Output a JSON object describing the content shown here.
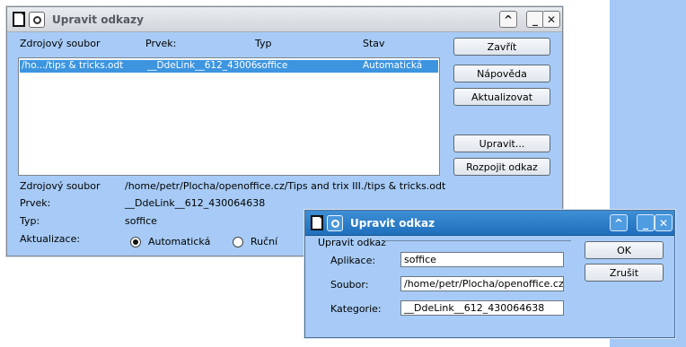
{
  "main_dialog": {
    "title": "Upravit odkazy",
    "headers": {
      "source": "Zdrojový soubor",
      "element": "Prvek:",
      "type": "Typ",
      "status": "Stav"
    },
    "selected_row": {
      "source": "/ho.../tips & tricks.odt",
      "element": "__DdeLink__612_43006",
      "type": "soffice",
      "status": "Automatická"
    },
    "buttons": {
      "close": "Zavřít",
      "help": "Nápověda",
      "update": "Aktualizovat",
      "edit": "Upravit...",
      "break": "Rozpojit odkaz"
    },
    "details": {
      "source_label": "Zdrojový soubor",
      "source_value": "/home/petr/Plocha/openoffice.cz/Tips and trix III./tips & tricks.odt",
      "element_label": "Prvek:",
      "element_value": "__DdeLink__612_430064638",
      "type_label": "Typ:",
      "type_value": "soffice"
    },
    "update_mode": {
      "label": "Aktualizace:",
      "auto": "Automatická",
      "manual": "Ruční",
      "selected": "auto"
    },
    "titlebar_glyphs": {
      "shade": "^",
      "minimize": "_",
      "close": "✕"
    }
  },
  "edit_dialog": {
    "title": "Upravit odkaz",
    "group": "Upravit odkaz",
    "application_label": "Aplikace:",
    "application_value": "soffice",
    "file_label": "Soubor:",
    "file_value": "/home/petr/Plocha/openoffice.cz/Tip",
    "category_label": "Kategorie:",
    "category_value": "__DdeLink__612_430064638",
    "ok": "OK",
    "cancel": "Zrušit"
  },
  "colors": {
    "dialog_bg": "#a7cbf6",
    "selection": "#3d95e0",
    "active_title": "#2a7bc8"
  },
  "icons": [
    "document-icon",
    "window-menu-icon",
    "shade-icon",
    "minimize-icon",
    "close-icon"
  ]
}
